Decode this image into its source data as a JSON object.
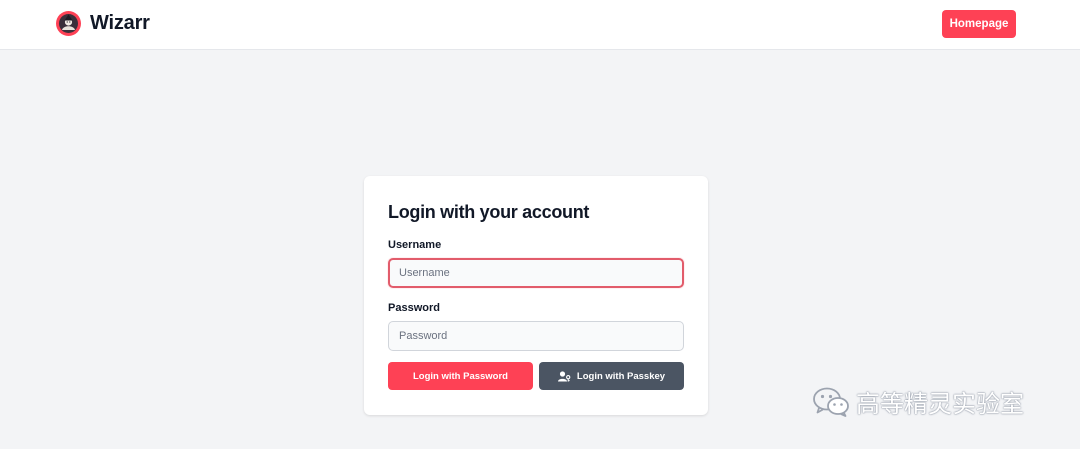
{
  "navbar": {
    "brand_name": "Wizarr",
    "homepage_button": "Homepage"
  },
  "login": {
    "title": "Login with your account",
    "username_label": "Username",
    "username_placeholder": "Username",
    "username_value": "",
    "password_label": "Password",
    "password_placeholder": "Password",
    "password_value": "",
    "password_button": "Login with Password",
    "passkey_button": "Login with Passkey"
  },
  "watermark": {
    "text": "高等精灵实验室",
    "icon": "wechat-icon"
  },
  "colors": {
    "accent": "#fe4155",
    "secondary_button": "#4b5563",
    "background": "#f3f4f6"
  }
}
